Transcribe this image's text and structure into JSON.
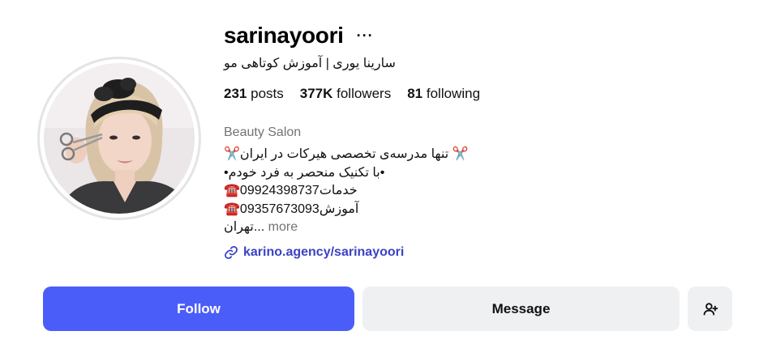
{
  "profile": {
    "username": "sarinayoori",
    "more_icon_text": "···",
    "full_name": "سارینا یوری | آموزش کوتاهی مو",
    "category": "Beauty Salon"
  },
  "stats": {
    "posts_count": "231",
    "posts_label": "posts",
    "followers_count": "377K",
    "followers_label": "followers",
    "following_count": "81",
    "following_label": "following"
  },
  "bio": {
    "line1": "✂️تنها مدرسه‌ی تخصصی هیرکات در ایران ✂️",
    "line2": "•با تکنیک منحصر به فرد خودم•",
    "line3": "☎️09924398737خدمات",
    "line4": "☎️09357673093آموزش",
    "line5_text": "تهران...",
    "more_label": "more"
  },
  "link": {
    "url_text": "karino.agency/sarinayoori"
  },
  "actions": {
    "follow_label": "Follow",
    "message_label": "Message"
  },
  "colors": {
    "follow_bg": "#4a5df9",
    "secondary_bg": "#eff0f2",
    "link": "#3b42c4",
    "muted": "#737373"
  },
  "icons": {
    "more": "more-horizontal-icon",
    "link": "link-icon",
    "add_user": "person-add-icon"
  }
}
